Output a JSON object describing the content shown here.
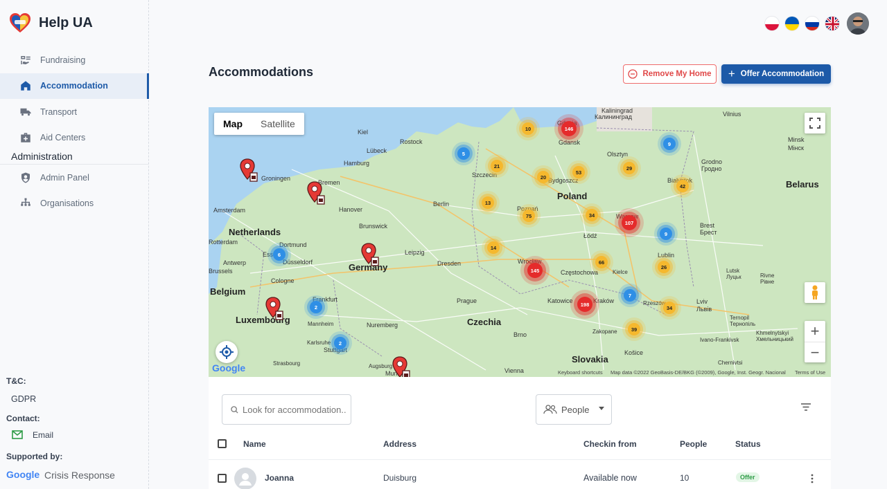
{
  "app": {
    "name": "Help UA"
  },
  "sidebar": {
    "items": [
      {
        "label": "Fundraising",
        "icon": "fundraising-icon"
      },
      {
        "label": "Accommodation",
        "icon": "home-icon",
        "active": true
      },
      {
        "label": "Transport",
        "icon": "truck-icon"
      },
      {
        "label": "Aid Centers",
        "icon": "medkit-icon"
      }
    ],
    "admin_section": "Administration",
    "admin_items": [
      {
        "label": "Admin Panel",
        "icon": "shield-icon"
      },
      {
        "label": "Organisations",
        "icon": "org-tree-icon"
      }
    ],
    "footer": {
      "tc_heading": "T&C:",
      "gdpr": "GDPR",
      "contact_heading": "Contact:",
      "email": "Email",
      "supported_heading": "Supported by:",
      "google": "Google",
      "crisis": "Crisis Response"
    }
  },
  "header": {
    "languages": [
      "pl",
      "ua",
      "ru",
      "en"
    ],
    "title": "Accommodations",
    "remove_label": "Remove My Home",
    "offer_label": "Offer Accommodation"
  },
  "map": {
    "toggle": {
      "map": "Map",
      "satellite": "Satellite"
    },
    "countries": [
      "Netherlands",
      "Germany",
      "Belgium",
      "Luxembourg",
      "Czechia",
      "Slovakia",
      "Poland",
      "Belarus"
    ],
    "cities": [
      "Kaliningrad",
      "Калининград",
      "Vilnius",
      "Gdynia",
      "Gdansk",
      "Minsk",
      "Мінск",
      "Olsztyn",
      "Grodno",
      "Гродно",
      "Białystok",
      "Kiel",
      "Rostock",
      "Lübeck",
      "Hamburg",
      "Szczecin",
      "Bydgoszcz",
      "Groningen",
      "Bremen",
      "Amsterdam",
      "Hanover",
      "Berlin",
      "Poznań",
      "Warsaw",
      "Brest",
      "Брест",
      "Brunswick",
      "Rotterdam",
      "Dortmund",
      "Essen",
      "Düsseldorf",
      "Leipzig",
      "Łódź",
      "Antwerp",
      "Brussels",
      "Cologne",
      "Dresden",
      "Wrocław",
      "Częstochowa",
      "Lublin",
      "Kielce",
      "Lutsk",
      "Луцьк",
      "Rivne",
      "Рівне",
      "Frankfurt",
      "Prague",
      "Katowice",
      "Kraków",
      "Rzeszów",
      "Lviv",
      "Львів",
      "Mannheim",
      "Nuremberg",
      "Ternopil",
      "Тернопіль",
      "Zakopane",
      "Brno",
      "Karlsruhe",
      "Stuttgart",
      "Ivano-Frankivsk",
      "Khmelnytskyi",
      "Хмельницький",
      "Košice",
      "Strasbourg",
      "Augsburg",
      "Munich",
      "Vienna",
      "Chernivtsi"
    ],
    "clusters": [
      {
        "count": "10",
        "color": "yellow"
      },
      {
        "count": "146",
        "color": "red"
      },
      {
        "count": "9",
        "color": "blue"
      },
      {
        "count": "5",
        "color": "blue"
      },
      {
        "count": "21",
        "color": "yellow"
      },
      {
        "count": "53",
        "color": "yellow"
      },
      {
        "count": "29",
        "color": "yellow"
      },
      {
        "count": "20",
        "color": "yellow"
      },
      {
        "count": "42",
        "color": "yellow"
      },
      {
        "count": "13",
        "color": "yellow"
      },
      {
        "count": "75",
        "color": "yellow"
      },
      {
        "count": "34",
        "color": "yellow"
      },
      {
        "count": "107",
        "color": "red"
      },
      {
        "count": "9",
        "color": "blue"
      },
      {
        "count": "14",
        "color": "yellow"
      },
      {
        "count": "6",
        "color": "blue"
      },
      {
        "count": "145",
        "color": "red"
      },
      {
        "count": "66",
        "color": "yellow"
      },
      {
        "count": "26",
        "color": "yellow"
      },
      {
        "count": "2",
        "color": "blue"
      },
      {
        "count": "198",
        "color": "red"
      },
      {
        "count": "7",
        "color": "blue"
      },
      {
        "count": "34",
        "color": "yellow"
      },
      {
        "count": "39",
        "color": "yellow"
      },
      {
        "count": "2",
        "color": "blue"
      }
    ],
    "google_logo": "Google",
    "attribution": {
      "shortcuts": "Keyboard shortcuts",
      "data": "Map data ©2022 GeoBasis-DE/BKG (©2009), Google, Inst. Geogr. Nacional",
      "terms": "Terms of Use"
    }
  },
  "table": {
    "search_placeholder": "Look for accommodation...",
    "people_filter": "People",
    "columns": [
      "Name",
      "Address",
      "Checkin from",
      "People",
      "Status"
    ],
    "rows": [
      {
        "name": "Joanna",
        "address": "Duisburg",
        "checkin": "Available now",
        "people": "10",
        "status": "Offer"
      }
    ]
  },
  "colors": {
    "primary": "#1d5aa8",
    "danger": "#e04848",
    "offer_badge": "#2e9b46"
  }
}
